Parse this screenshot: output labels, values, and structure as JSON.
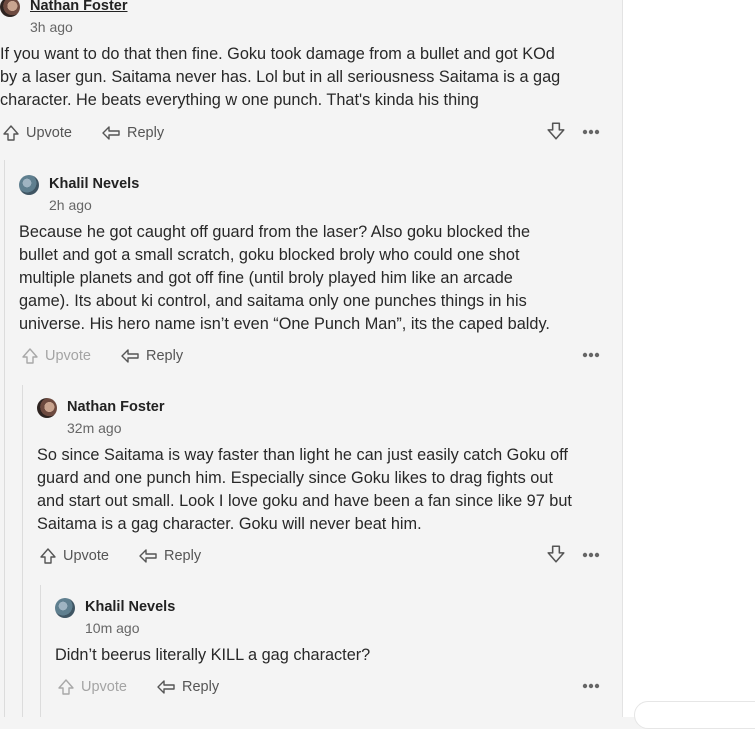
{
  "comments": [
    {
      "author": "Nathan Foster",
      "time": "3h ago",
      "lines": [
        "If you want to do that then fine. Goku took damage from a bullet and got KOd",
        "by a laser gun. Saitama never has. Lol but in all seriousness Saitama is a gag",
        "character. He beats everything w one punch. That's kinda his thing"
      ],
      "upvote": "Upvote",
      "reply": "Reply"
    },
    {
      "author": "Khalil Nevels",
      "time": "2h ago",
      "lines": [
        "Because he got caught off guard from the laser? Also goku blocked the",
        "bullet and got a small scratch, goku blocked broly who could one shot",
        "multiple planets and got off fine (until broly played him like an arcade",
        "game). Its about ki control, and saitama only one punches things in his",
        "universe. His hero name isn’t even “One Punch Man”, its the caped baldy."
      ],
      "upvote": "Upvote",
      "reply": "Reply"
    },
    {
      "author": "Nathan Foster",
      "time": "32m ago",
      "lines": [
        "So since Saitama is way faster than light he can just easily catch Goku off",
        "guard and one punch him. Especially since Goku likes to drag fights out",
        "and start out small. Look I love goku and have been a fan since like 97 but",
        "Saitama is a gag character. Goku will never beat him."
      ],
      "upvote": "Upvote",
      "reply": "Reply"
    },
    {
      "author": "Khalil Nevels",
      "time": "10m ago",
      "lines": [
        "Didn’t beerus literally KILL a gag character?"
      ],
      "upvote": "Upvote",
      "reply": "Reply"
    }
  ]
}
